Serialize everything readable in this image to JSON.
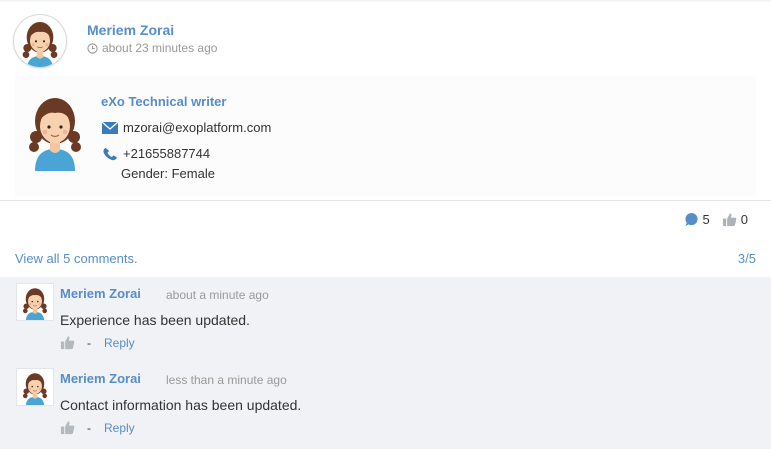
{
  "activity": {
    "author": "Meriem Zorai",
    "time": "about 23 minutes ago"
  },
  "profile": {
    "title": "eXo Technical writer",
    "email": "mzorai@exoplatform.com",
    "phone": "+21655887744",
    "gender": "Gender: Female"
  },
  "counters": {
    "comments": "5",
    "likes": "0"
  },
  "comments_section": {
    "view_all": "View all 5 comments.",
    "pager": "3/5",
    "items": [
      {
        "author": "Meriem Zorai",
        "time": "about a minute ago",
        "text": "Experience has been updated.",
        "separator": "-",
        "reply": "Reply"
      },
      {
        "author": "Meriem Zorai",
        "time": "less than a minute ago",
        "text": "Contact information has been updated.",
        "separator": "-",
        "reply": "Reply"
      }
    ]
  },
  "colors": {
    "link": "#578dc9",
    "comment_bg": "#f0f2f5",
    "muted": "#999999"
  },
  "icons": [
    "clock-icon",
    "envelope-icon",
    "phone-icon",
    "comment-icon",
    "thumbs-up-icon"
  ]
}
